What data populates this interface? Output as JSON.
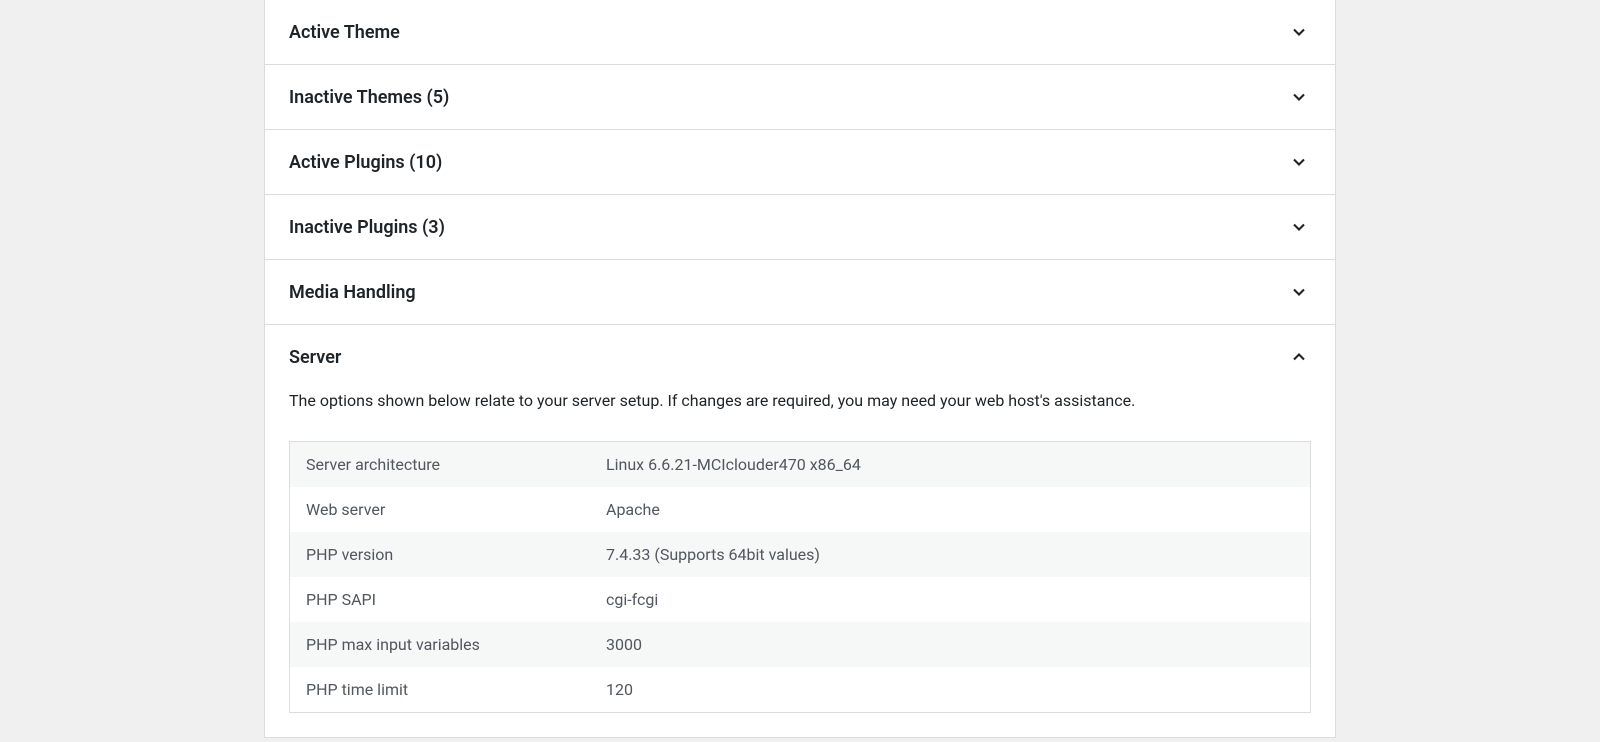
{
  "sections": {
    "active_theme": {
      "title": "Active Theme",
      "expanded": false
    },
    "inactive_themes": {
      "title": "Inactive Themes (5)",
      "expanded": false
    },
    "active_plugins": {
      "title": "Active Plugins (10)",
      "expanded": false
    },
    "inactive_plugins": {
      "title": "Inactive Plugins (3)",
      "expanded": false
    },
    "media_handling": {
      "title": "Media Handling",
      "expanded": false
    },
    "server": {
      "title": "Server",
      "expanded": true,
      "description": "The options shown below relate to your server setup. If changes are required, you may need your web host's assistance.",
      "rows": [
        {
          "label": "Server architecture",
          "value": "Linux 6.6.21-MCIclouder470 x86_64"
        },
        {
          "label": "Web server",
          "value": "Apache"
        },
        {
          "label": "PHP version",
          "value": "7.4.33 (Supports 64bit values)"
        },
        {
          "label": "PHP SAPI",
          "value": "cgi-fcgi"
        },
        {
          "label": "PHP max input variables",
          "value": "3000"
        },
        {
          "label": "PHP time limit",
          "value": "120"
        }
      ]
    }
  }
}
